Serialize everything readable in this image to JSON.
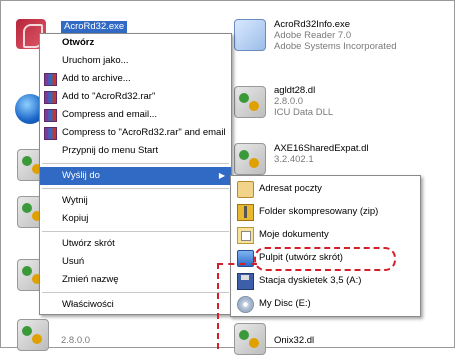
{
  "background_files": [
    {
      "name": "AcroRd32.exe",
      "icon": "pdf-icon"
    },
    {
      "name": "AcroRd32Info.exe",
      "sub1": "Adobe Reader 7.0",
      "sub2": "Adobe Systems Incorporated",
      "icon": "exe-icon"
    },
    {
      "name": "agldt28.dl",
      "sub1": "2.8.0.0",
      "sub2": "ICU Data DLL",
      "icon": "dll-icon"
    },
    {
      "name": "AXE16SharedExpat.dl",
      "sub1": "3.2.402.1",
      "icon": "dll-icon"
    },
    {
      "name": "Onix32.dl",
      "icon": "dll-icon"
    },
    {
      "version": "2.8.0.0"
    }
  ],
  "context_menu": {
    "items": [
      {
        "label": "Otwórz",
        "bold": true
      },
      {
        "label": "Uruchom jako..."
      },
      {
        "label": "Add to archive...",
        "icon": "winrar-icon"
      },
      {
        "label": "Add to \"AcroRd32.rar\"",
        "icon": "winrar-icon"
      },
      {
        "label": "Compress and email...",
        "icon": "winrar-icon"
      },
      {
        "label": "Compress to \"AcroRd32.rar\" and email",
        "icon": "winrar-icon"
      },
      {
        "label": "Przypnij do menu Start"
      },
      {
        "label": "Wyślij do",
        "highlighted": true,
        "submenu": true
      },
      {
        "label": "Wytnij"
      },
      {
        "label": "Kopiuj"
      },
      {
        "label": "Utwórz skrót"
      },
      {
        "label": "Usuń"
      },
      {
        "label": "Zmień nazwę"
      },
      {
        "label": "Właściwości"
      }
    ]
  },
  "sendto_menu": {
    "items": [
      {
        "label": "Adresat poczty",
        "icon": "mail-icon"
      },
      {
        "label": "Folder skompresowany (zip)",
        "icon": "zip-folder-icon"
      },
      {
        "label": "Moje dokumenty",
        "icon": "my-documents-icon"
      },
      {
        "label": "Pulpit (utwórz skrót)",
        "icon": "desktop-icon"
      },
      {
        "label": "Stacja dyskietek 3,5 (A:)",
        "icon": "floppy-icon"
      },
      {
        "label": "My Disc (E:)",
        "icon": "disc-icon"
      }
    ]
  },
  "colors": {
    "highlight": "#316ac5",
    "annotation": "#d21f2a"
  }
}
